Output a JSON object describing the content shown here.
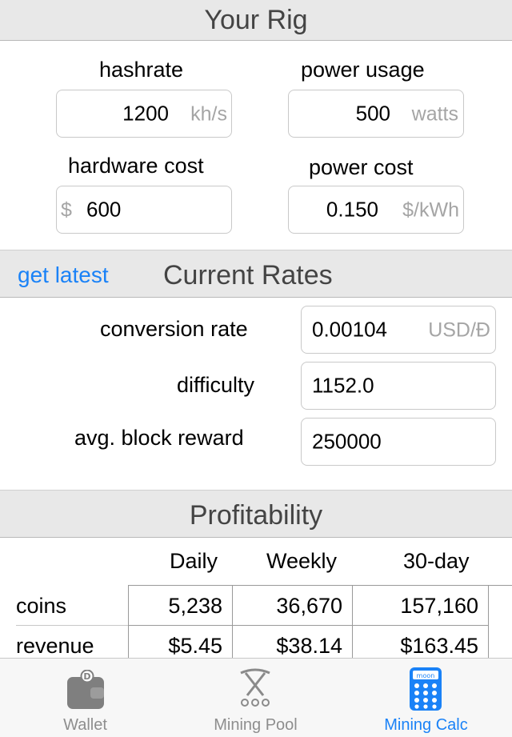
{
  "rig": {
    "title": "Your Rig",
    "hashrate_label": "hashrate",
    "hashrate_value": "1200",
    "hashrate_unit": "kh/s",
    "power_usage_label": "power usage",
    "power_usage_value": "500",
    "power_usage_unit": "watts",
    "hardware_cost_label": "hardware cost",
    "hardware_cost_prefix": "$",
    "hardware_cost_value": "600",
    "power_cost_label": "power cost",
    "power_cost_value": "0.150",
    "power_cost_unit": "$/kWh"
  },
  "rates": {
    "title": "Current Rates",
    "get_latest": "get latest",
    "conversion_label": "conversion rate",
    "conversion_value": "0.00104",
    "conversion_unit": "USD/Đ",
    "difficulty_label": "difficulty",
    "difficulty_value": "1152.0",
    "reward_label": "avg. block reward",
    "reward_value": "250000"
  },
  "profitability": {
    "title": "Profitability",
    "columns": [
      "Daily",
      "Weekly",
      "30-day"
    ],
    "rows": [
      {
        "label": "coins",
        "values": [
          "5,238",
          "36,670",
          "157,160"
        ]
      },
      {
        "label": "revenue",
        "values": [
          "$5.45",
          "$38.14",
          "$163.45"
        ]
      }
    ]
  },
  "tabbar": {
    "tabs": [
      {
        "label": "Wallet",
        "icon": "wallet-icon",
        "active": false
      },
      {
        "label": "Mining Pool",
        "icon": "pickaxe-icon",
        "active": false
      },
      {
        "label": "Mining Calc",
        "icon": "calculator-icon",
        "active": true,
        "icon_text": "moon"
      }
    ]
  },
  "colors": {
    "accent": "#1a82f7",
    "header_bg": "#e8e8e8",
    "placeholder": "#a5a5a5"
  }
}
